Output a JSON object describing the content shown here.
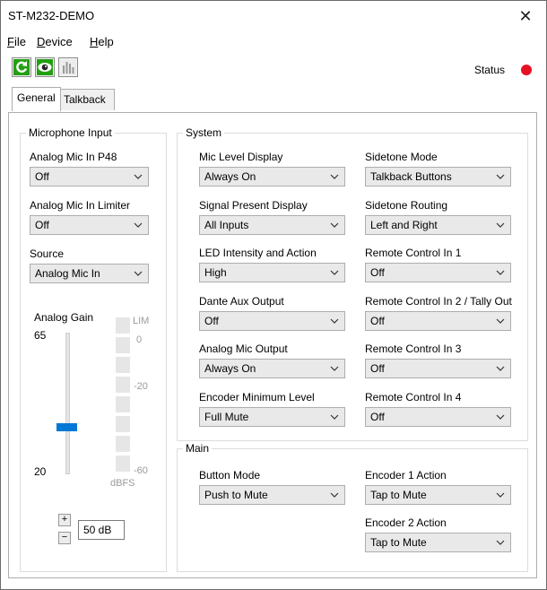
{
  "window": {
    "title": "ST-M232-DEMO",
    "close_glyph": "✕"
  },
  "menu": [
    {
      "mnemonic": "F",
      "rest": "ile"
    },
    {
      "mnemonic": "D",
      "rest": "evice"
    },
    {
      "mnemonic": "H",
      "rest": "elp"
    }
  ],
  "toolbar": {
    "icons": [
      "refresh-icon",
      "eye-icon",
      "meters-icon"
    ],
    "status_label": "Status",
    "status_color": "#e81123"
  },
  "tabs": [
    {
      "label": "General",
      "active": true
    },
    {
      "label": "Talkback Channels",
      "active": false
    }
  ],
  "mic_input": {
    "title": "Microphone Input",
    "fields": [
      {
        "label": "Analog Mic In P48",
        "value": "Off"
      },
      {
        "label": "Analog Mic In Limiter",
        "value": "Off"
      },
      {
        "label": "Source",
        "value": "Analog Mic In"
      }
    ],
    "gain": {
      "label": "Analog Gain",
      "max_label": "65",
      "min_label": "20",
      "value_text": "50 dB",
      "slider_level": 0.33,
      "meter_labels": [
        "LIM",
        "0",
        "-20",
        "-60",
        "dBFS"
      ],
      "plus": "+",
      "minus": "−"
    }
  },
  "system": {
    "title": "System",
    "left": [
      {
        "label": "Mic Level Display",
        "value": "Always On"
      },
      {
        "label": "Signal Present Display",
        "value": "All Inputs"
      },
      {
        "label": "LED Intensity and Action",
        "value": "High"
      },
      {
        "label": "Dante Aux Output",
        "value": "Off"
      },
      {
        "label": "Analog Mic Output",
        "value": "Always On"
      },
      {
        "label": "Encoder Minimum Level",
        "value": "Full Mute"
      }
    ],
    "right": [
      {
        "label": "Sidetone Mode",
        "value": "Talkback Buttons"
      },
      {
        "label": "Sidetone Routing",
        "value": "Left and Right"
      },
      {
        "label": "Remote Control In 1",
        "value": "Off"
      },
      {
        "label": "Remote Control In 2 / Tally Out",
        "value": "Off"
      },
      {
        "label": "Remote Control In 3",
        "value": "Off"
      },
      {
        "label": "Remote Control In 4",
        "value": "Off"
      }
    ]
  },
  "main": {
    "title": "Main",
    "button_mode": {
      "label": "Button Mode",
      "value": "Push to Mute"
    },
    "encoder1": {
      "label": "Encoder 1 Action",
      "value": "Tap to Mute"
    },
    "encoder2": {
      "label": "Encoder 2 Action",
      "value": "Tap to Mute"
    }
  }
}
